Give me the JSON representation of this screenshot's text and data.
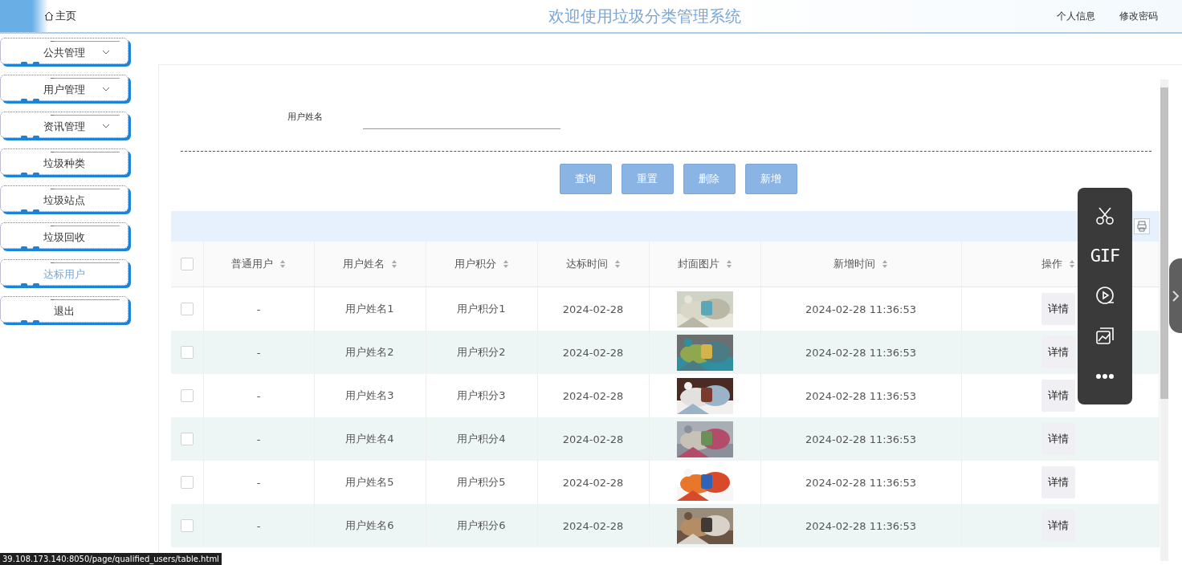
{
  "header": {
    "home_link": "主页",
    "title": "欢迎使用垃圾分类管理系统",
    "links": [
      "个人信息",
      "修改密码"
    ]
  },
  "sidebar": {
    "items": [
      {
        "label": "公共管理",
        "kind": "group",
        "selected": false
      },
      {
        "label": "用户管理",
        "kind": "group",
        "selected": false
      },
      {
        "label": "资讯管理",
        "kind": "group",
        "selected": false
      },
      {
        "label": "垃圾种类",
        "kind": "link",
        "selected": false
      },
      {
        "label": "垃圾站点",
        "kind": "link",
        "selected": false
      },
      {
        "label": "垃圾回收",
        "kind": "link",
        "selected": false
      },
      {
        "label": "达标用户",
        "kind": "link",
        "selected": true
      },
      {
        "label": "退出",
        "kind": "link",
        "selected": false
      }
    ]
  },
  "search": {
    "label": "用户姓名"
  },
  "buttons": [
    "查询",
    "重置",
    "删除",
    "新增"
  ],
  "table": {
    "select_all": {
      "checked": false
    },
    "columns": [
      "普通用户",
      "用户姓名",
      "用户积分",
      "达标时间",
      "封面图片",
      "新增时间",
      "操作"
    ],
    "rows": [
      {
        "checked": false,
        "cells": [
          "-",
          "用户姓名1",
          "用户积分1",
          "2024-02-28"
        ],
        "added": "2024-02-28 11:36:53",
        "action": "详情"
      },
      {
        "checked": false,
        "cells": [
          "-",
          "用户姓名2",
          "用户积分2",
          "2024-02-28"
        ],
        "added": "2024-02-28 11:36:53",
        "action": "详情"
      },
      {
        "checked": false,
        "cells": [
          "-",
          "用户姓名3",
          "用户积分3",
          "2024-02-28"
        ],
        "added": "2024-02-28 11:36:53",
        "action": "详情"
      },
      {
        "checked": false,
        "cells": [
          "-",
          "用户姓名4",
          "用户积分4",
          "2024-02-28"
        ],
        "added": "2024-02-28 11:36:53",
        "action": "详情"
      },
      {
        "checked": false,
        "cells": [
          "-",
          "用户姓名5",
          "用户积分5",
          "2024-02-28"
        ],
        "added": "2024-02-28 11:36:53",
        "action": "详情"
      },
      {
        "checked": false,
        "cells": [
          "-",
          "用户姓名6",
          "用户积分6",
          "2024-02-28"
        ],
        "added": "2024-02-28 11:36:53",
        "action": "详情"
      }
    ]
  },
  "capture_toolbar": {
    "gif_label": "GIF"
  },
  "status_url": "39.108.173.140:8050/page/qualified_users/table.html"
}
